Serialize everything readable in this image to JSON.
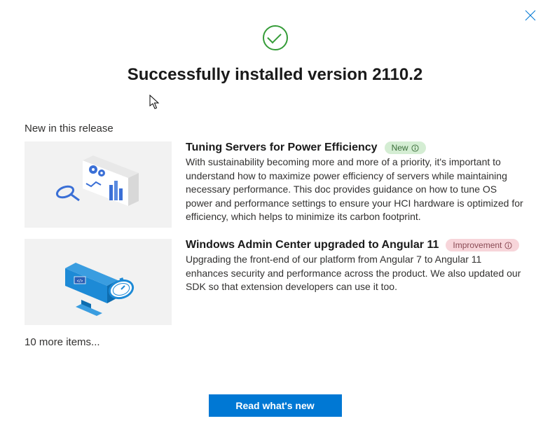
{
  "header": {
    "title": "Successfully installed version 2110.2"
  },
  "section_label": "New in this release",
  "items": [
    {
      "title": "Tuning Servers for Power Efficiency",
      "badge": "New",
      "badge_type": "new",
      "description": "With sustainability becoming more and more of a priority, it's important to understand how to maximize power efficiency of servers while maintaining necessary performance. This doc provides guidance on how to tune OS power and performance settings to ensure your HCI hardware is optimized for efficiency, which helps to minimize its carbon footprint."
    },
    {
      "title": "Windows Admin Center upgraded to Angular 11",
      "badge": "Improvement",
      "badge_type": "improvement",
      "description": "Upgrading the front-end of our platform from Angular 7 to Angular 11 enhances security and performance across the product. We also updated our SDK so that extension developers can use it too."
    }
  ],
  "more_items_label": "10 more items...",
  "footer": {
    "button_label": "Read what's new"
  }
}
